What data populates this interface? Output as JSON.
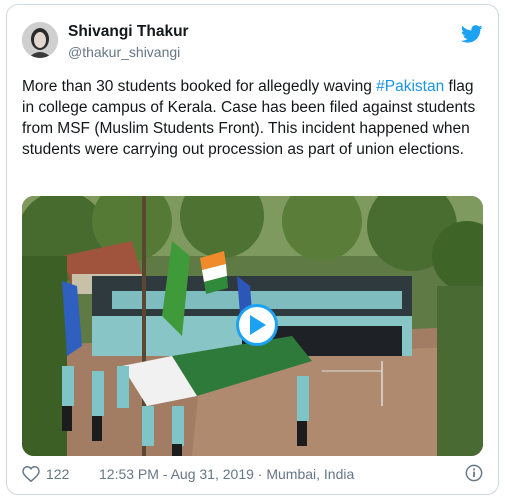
{
  "tweet": {
    "author_name": "Shivangi Thakur",
    "author_handle": "@thakur_shivangi",
    "text_before": "More than 30 students booked for allegedly waving ",
    "hashtag": "#Pakistan",
    "text_after": " flag in college campus of Kerala. Case has been filed against students from MSF (Muslim Students Front). This incident happened when students were carrying out procession as part of union elections.",
    "likes": "122",
    "timestamp": "12:53 PM - Aug 31, 2019 · Mumbai, India"
  },
  "icons": {
    "brand": "twitter-bird-icon",
    "like": "heart-icon",
    "info": "info-icon",
    "play": "play-icon"
  },
  "colors": {
    "twitter_blue": "#1da1f2",
    "link": "#1b95e0",
    "text": "#14171a",
    "muted": "#657786",
    "border": "#cfd9de"
  }
}
